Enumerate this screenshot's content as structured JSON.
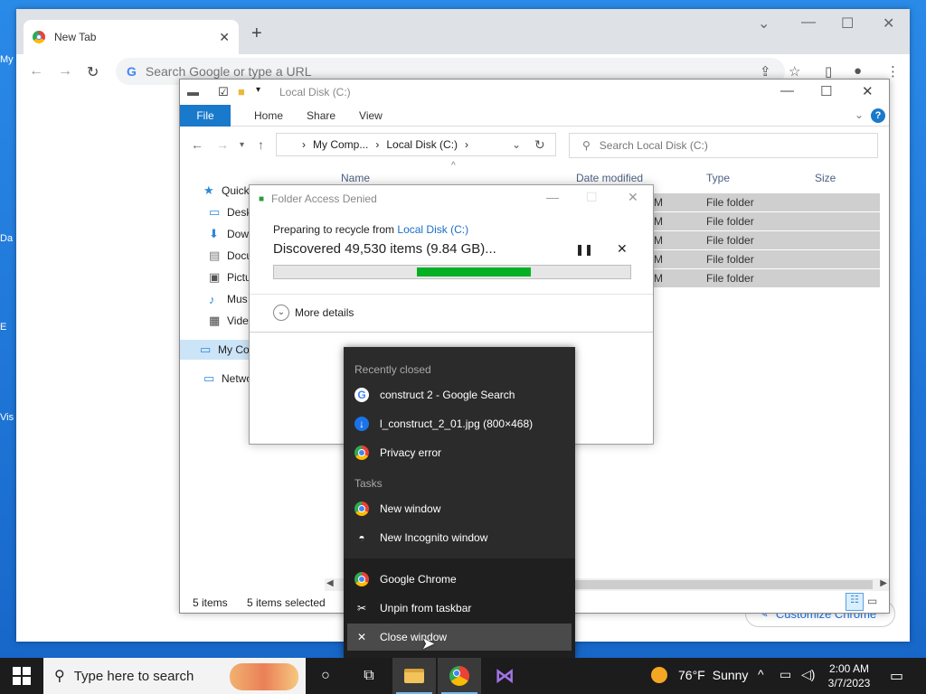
{
  "desktop": {
    "icons": [
      "My",
      "Da",
      "E",
      "Vis"
    ]
  },
  "chrome": {
    "tab_title": "New Tab",
    "omnibox_placeholder": "Search Google or type a URL",
    "customize_label": "Customize Chrome"
  },
  "explorer": {
    "title": "Local Disk (C:)",
    "ribbon": {
      "file": "File",
      "tabs": [
        "Home",
        "Share",
        "View"
      ]
    },
    "address": {
      "crumbs": [
        "My Comp...",
        "Local Disk (C:)"
      ]
    },
    "search_placeholder": "Search Local Disk (C:)",
    "columns": {
      "name": "Name",
      "date_modified": "Date modified",
      "type": "Type",
      "size": "Size"
    },
    "nav": {
      "quick": "Quick",
      "desktop": "Desk",
      "downloads": "Dow",
      "documents": "Docu",
      "pictures": "Pictu",
      "music": "Mus",
      "videos": "Vide",
      "my_computer": "My Computer",
      "network": "Network"
    },
    "rows": [
      {
        "date": "M",
        "type": "File folder"
      },
      {
        "date": "M",
        "type": "File folder"
      },
      {
        "date": "M",
        "type": "File folder"
      },
      {
        "date": "PM",
        "type": "File folder"
      },
      {
        "date": "M",
        "type": "File folder"
      }
    ],
    "status": {
      "items": "5 items",
      "selected": "5 items selected"
    }
  },
  "dialog": {
    "title": "Folder Access Denied",
    "preparing_text": "Preparing to recycle from",
    "location_link": "Local Disk (C:)",
    "discovered_text": "Discovered 49,530 items (9.84 GB)...",
    "progress_indeterminate_start": 0.4,
    "progress_indeterminate_end": 0.72,
    "more_details": "More details"
  },
  "jumplist": {
    "recently_closed_header": "Recently closed",
    "recently_closed": [
      "construct 2 - Google Search",
      "l_construct_2_01.jpg (800×468)",
      "Privacy error"
    ],
    "tasks_header": "Tasks",
    "tasks": [
      "New window",
      "New Incognito window"
    ],
    "pinned": [
      "Google Chrome",
      "Unpin from taskbar",
      "Close window"
    ]
  },
  "taskbar": {
    "search_placeholder": "Type here to search",
    "weather_temp": "76°F",
    "weather_desc": "Sunny",
    "time": "2:00 AM",
    "date": "3/7/2023"
  }
}
